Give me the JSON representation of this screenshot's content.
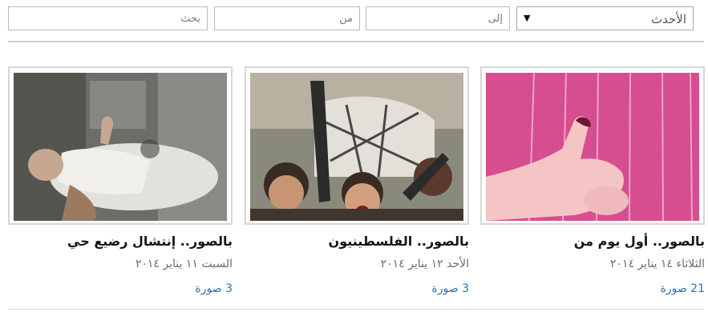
{
  "filters": {
    "sort": {
      "selected": "الأحدث",
      "arrow_icon": "dropdown-arrow"
    },
    "to_placeholder": "إلى",
    "from_placeholder": "من",
    "search_placeholder": "بحث"
  },
  "albums": [
    {
      "title": "بالصور.. أول يوم من",
      "date": "الثلاثاء ١٤ يناير ٢٠١٤",
      "count": "21 صورة"
    },
    {
      "title": "بالصور.. الفلسطينيون",
      "date": "الأحد ١٢ يناير ٢٠١٤",
      "count": "3 صورة"
    },
    {
      "title": "بالصور.. إنتشال رضيع حي",
      "date": "السبت ١١ يناير ٢٠١٤",
      "count": "3 صورة"
    }
  ],
  "colors": {
    "link": "#2b73b6",
    "border": "#d6d6d6"
  }
}
